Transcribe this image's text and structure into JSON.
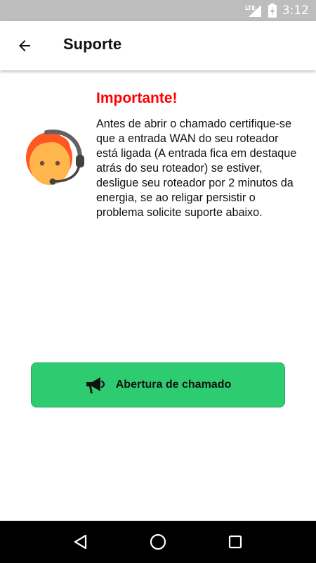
{
  "status_bar": {
    "network_label": "LTE",
    "time": "3:12",
    "icons": [
      "lte-signal-icon",
      "battery-charging-icon"
    ]
  },
  "app_bar": {
    "title": "Suporte",
    "back_icon": "arrow-left-icon"
  },
  "notice": {
    "heading": "Importante!",
    "body": "Antes de abrir o chamado certifique-se que a entrada WAN do seu roteador está ligada (A entrada fica em destaque atrás do seu roteador) se estiver, desligue seu roteador por 2 minutos da energia, se ao religar persistir o problema solicite suporte abaixo.",
    "avatar_icon": "support-agent-headset-icon"
  },
  "actions": {
    "open_ticket_label": "Abertura de chamado",
    "open_ticket_icon": "megaphone-icon"
  },
  "nav_bar": {
    "icons": [
      "back-triangle-icon",
      "home-circle-icon",
      "recents-square-icon"
    ]
  },
  "colors": {
    "status_bar": "#bdbdbd",
    "heading": "#ff0000",
    "button_bg": "#2ecc71",
    "nav_bar": "#000000"
  }
}
